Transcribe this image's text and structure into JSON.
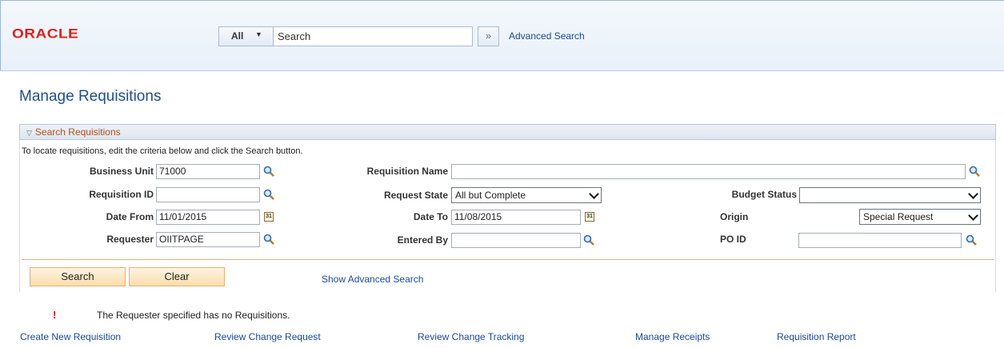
{
  "header": {
    "logo_text": "ORACLE",
    "search_scope": "All",
    "search_placeholder": "Search",
    "advanced_search": "Advanced Search"
  },
  "page": {
    "title": "Manage Requisitions"
  },
  "panel": {
    "title": "Search Requisitions",
    "instructions": "To locate requisitions, edit the criteria below and click the Search button."
  },
  "fields": {
    "business_unit": {
      "label": "Business Unit",
      "value": "71000"
    },
    "requisition_name": {
      "label": "Requisition Name",
      "value": ""
    },
    "requisition_id": {
      "label": "Requisition ID",
      "value": ""
    },
    "request_state": {
      "label": "Request State",
      "value": "All but Complete"
    },
    "budget_status": {
      "label": "Budget Status",
      "value": ""
    },
    "date_from": {
      "label": "Date From",
      "value": "11/01/2015"
    },
    "date_to": {
      "label": "Date To",
      "value": "11/08/2015"
    },
    "origin": {
      "label": "Origin",
      "value": "Special Request"
    },
    "requester": {
      "label": "Requester",
      "value": "OIITPAGE"
    },
    "entered_by": {
      "label": "Entered By",
      "value": ""
    },
    "po_id": {
      "label": "PO ID",
      "value": ""
    }
  },
  "buttons": {
    "search": "Search",
    "clear": "Clear",
    "show_advanced": "Show Advanced Search"
  },
  "message": {
    "icon": "!",
    "text": "The Requester specified has no Requisitions."
  },
  "links": [
    "Create New Requisition",
    "Review Change Request",
    "Review Change Tracking",
    "Manage Receipts",
    "Requisition Report"
  ],
  "colors": {
    "brand_red": "#e0201a",
    "link_blue": "#1a4b9c",
    "title_blue": "#1e4f8f",
    "panel_title_orange": "#b5511b",
    "button_fill": "#fbdcaa"
  }
}
